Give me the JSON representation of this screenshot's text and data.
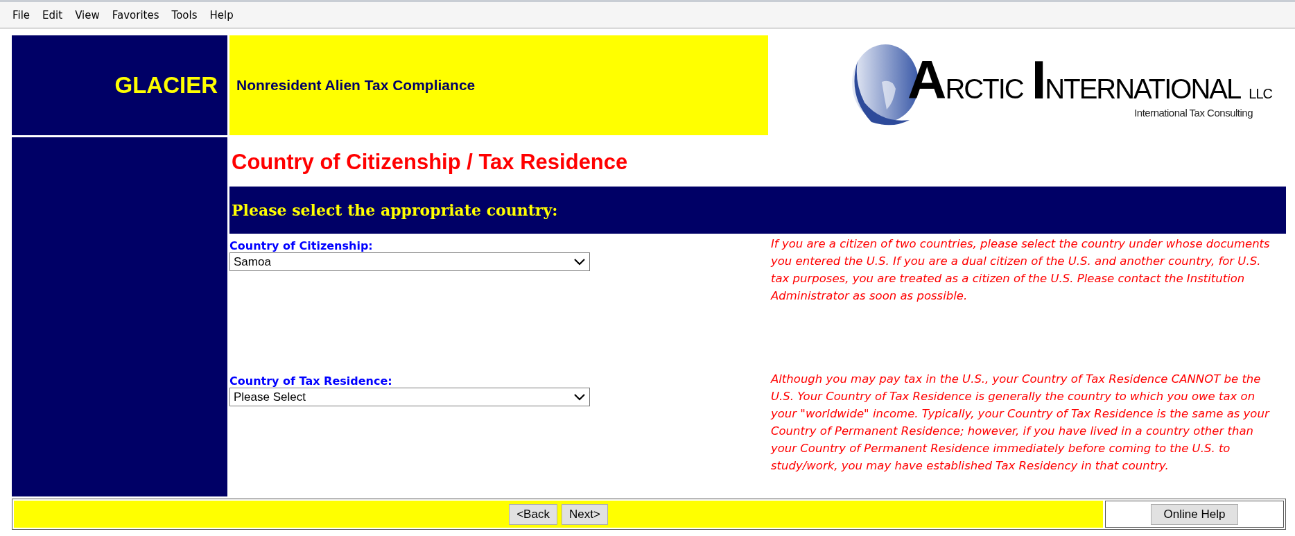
{
  "menu_bar": [
    "File",
    "Edit",
    "View",
    "Favorites",
    "Tools",
    "Help"
  ],
  "header": {
    "brand": "GLACIER",
    "subtitle": "Nonresident Alien Tax Compliance",
    "logo": {
      "words": [
        "ARCTIC",
        "INTERNATIONAL"
      ],
      "suffix": "LLC",
      "tagline": "International Tax Consulting"
    }
  },
  "page_title": "Country of Citizenship / Tax Residence",
  "section_heading": "Please select the appropriate country:",
  "fields": [
    {
      "label": "Country of Citizenship:",
      "value": "Samoa",
      "help": "If you are a citizen of two countries, please select the country under whose documents you entered the U.S. If you are a dual citizen of the U.S. and another country, for U.S. tax purposes, you are treated as a citizen of the U.S. Please contact the Institution Administrator as soon as possible."
    },
    {
      "label": "Country of Tax Residence:",
      "value": "Please Select",
      "help": "Although you may pay tax in the U.S., your Country of Tax Residence CANNOT be the U.S. Your Country of Tax Residence is generally the country to which you owe tax on your \"worldwide\" income. Typically, your Country of Tax Residence is the same as your Country of Permanent Residence; however, if you have lived in a country other than your Country of Permanent Residence immediately before coming to the U.S. to study/work, you may have established Tax Residency in that country."
    }
  ],
  "nav_buttons": [
    "<Back",
    "Next>"
  ],
  "help_button": "Online Help"
}
